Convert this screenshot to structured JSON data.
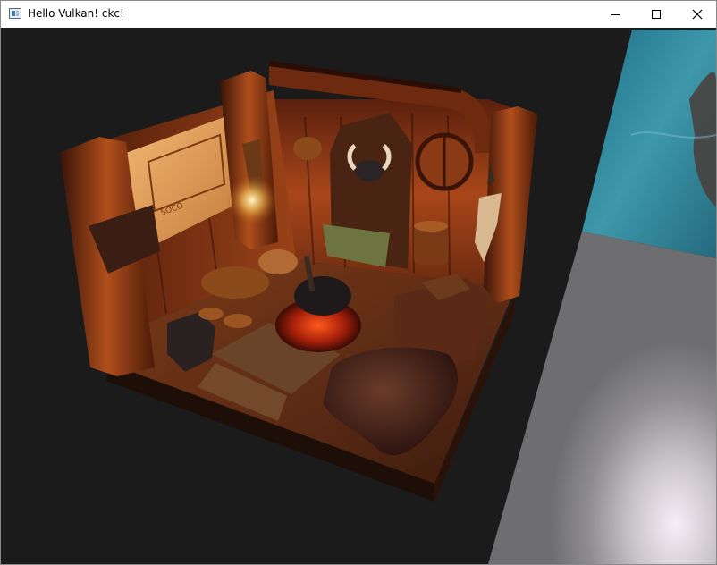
{
  "window": {
    "title": "Hello Vulkan! ckc!",
    "controls": [
      "minimize",
      "maximize",
      "close"
    ]
  },
  "icons": {
    "app": "app-window-icon",
    "minimize": "minimize-icon",
    "maximize": "maximize-icon",
    "close": "close-icon"
  },
  "scene": {
    "sign_text": "SOCO"
  }
}
